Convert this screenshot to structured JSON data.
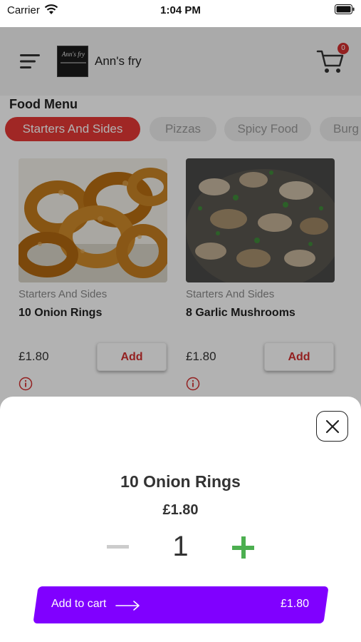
{
  "status_bar": {
    "carrier": "Carrier",
    "time": "1:04 PM"
  },
  "header": {
    "logo_text": "Ann's fry",
    "brand_name": "Ann's fry",
    "cart_count": "0"
  },
  "menu": {
    "section_title": "Food Menu",
    "tabs": [
      {
        "label": "Starters And Sides",
        "active": true
      },
      {
        "label": "Pizzas",
        "active": false
      },
      {
        "label": "Spicy Food",
        "active": false
      },
      {
        "label": "Burg",
        "active": false
      }
    ],
    "items": [
      {
        "category": "Starters And Sides",
        "name": "10 Onion Rings",
        "price": "£1.80",
        "add_label": "Add"
      },
      {
        "category": "Starters And Sides",
        "name": "8 Garlic Mushrooms",
        "price": "£1.80",
        "add_label": "Add"
      }
    ]
  },
  "sheet": {
    "item_name": "10 Onion Rings",
    "item_price": "£1.80",
    "quantity": "1",
    "cta_label": "Add to cart",
    "cta_total": "£1.80"
  },
  "colors": {
    "accent_red": "#e53935",
    "cta_purple": "#8000ff",
    "plus_green": "#4caf50"
  }
}
